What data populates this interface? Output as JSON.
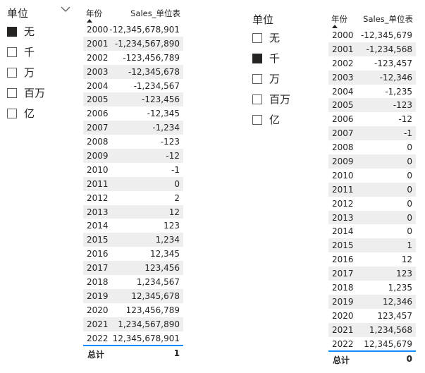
{
  "slicer_left": {
    "title": "单位",
    "options": [
      {
        "label": "无",
        "checked": true
      },
      {
        "label": "千",
        "checked": false
      },
      {
        "label": "万",
        "checked": false
      },
      {
        "label": "百万",
        "checked": false
      },
      {
        "label": "亿",
        "checked": false
      }
    ]
  },
  "slicer_right": {
    "title": "单位",
    "options": [
      {
        "label": "无",
        "checked": false
      },
      {
        "label": "千",
        "checked": true
      },
      {
        "label": "万",
        "checked": false
      },
      {
        "label": "百万",
        "checked": false
      },
      {
        "label": "亿",
        "checked": false
      }
    ]
  },
  "table_left": {
    "col_year": "年份",
    "col_sales": "Sales_单位表",
    "rows": [
      [
        "2000",
        "-12,345,678,901"
      ],
      [
        "2001",
        "-1,234,567,890"
      ],
      [
        "2002",
        "-123,456,789"
      ],
      [
        "2003",
        "-12,345,678"
      ],
      [
        "2004",
        "-1,234,567"
      ],
      [
        "2005",
        "-123,456"
      ],
      [
        "2006",
        "-12,345"
      ],
      [
        "2007",
        "-1,234"
      ],
      [
        "2008",
        "-123"
      ],
      [
        "2009",
        "-12"
      ],
      [
        "2010",
        "-1"
      ],
      [
        "2011",
        "0"
      ],
      [
        "2012",
        "2"
      ],
      [
        "2013",
        "12"
      ],
      [
        "2014",
        "123"
      ],
      [
        "2015",
        "1,234"
      ],
      [
        "2016",
        "12,345"
      ],
      [
        "2017",
        "123,456"
      ],
      [
        "2018",
        "1,234,567"
      ],
      [
        "2019",
        "12,345,678"
      ],
      [
        "2020",
        "123,456,789"
      ],
      [
        "2021",
        "1,234,567,890"
      ],
      [
        "2022",
        "12,345,678,901"
      ]
    ],
    "total_label": "总计",
    "total_value": "1"
  },
  "table_right": {
    "col_year": "年份",
    "col_sales": "Sales_单位表",
    "rows": [
      [
        "2000",
        "-12,345,679"
      ],
      [
        "2001",
        "-1,234,568"
      ],
      [
        "2002",
        "-123,457"
      ],
      [
        "2003",
        "-12,346"
      ],
      [
        "2004",
        "-1,235"
      ],
      [
        "2005",
        "-123"
      ],
      [
        "2006",
        "-12"
      ],
      [
        "2007",
        "-1"
      ],
      [
        "2008",
        "0"
      ],
      [
        "2009",
        "0"
      ],
      [
        "2010",
        "0"
      ],
      [
        "2011",
        "0"
      ],
      [
        "2012",
        "0"
      ],
      [
        "2013",
        "0"
      ],
      [
        "2014",
        "0"
      ],
      [
        "2015",
        "1"
      ],
      [
        "2016",
        "12"
      ],
      [
        "2017",
        "123"
      ],
      [
        "2018",
        "1,235"
      ],
      [
        "2019",
        "12,346"
      ],
      [
        "2020",
        "123,457"
      ],
      [
        "2021",
        "1,234,568"
      ],
      [
        "2022",
        "12,345,679"
      ]
    ],
    "total_label": "总计",
    "total_value": "0"
  },
  "colors": {
    "accent": "#118dff",
    "row_alt": "#eeeeee",
    "text": "#252423"
  }
}
